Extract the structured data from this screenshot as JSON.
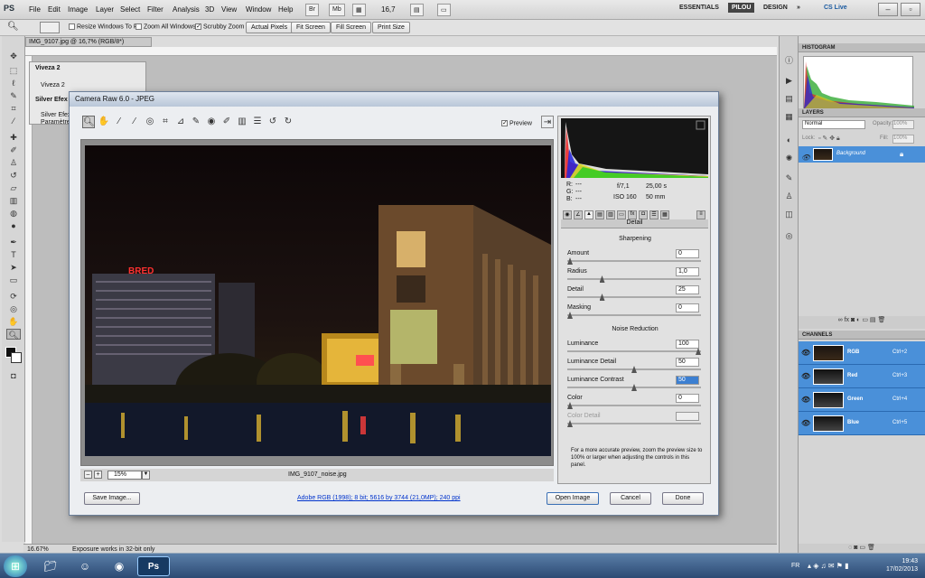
{
  "app": {
    "logo": "PS",
    "menu": [
      "File",
      "Edit",
      "Image",
      "Layer",
      "Select",
      "Filter",
      "Analysis",
      "3D",
      "View",
      "Window",
      "Help"
    ],
    "zoom_value": "16,7",
    "workspaces": [
      "ESSENTIALS",
      "PILOU",
      "DESIGN"
    ],
    "more": "»",
    "cslive": "CS Live"
  },
  "options": {
    "resize_windows": "Resize Windows To Fit",
    "zoom_all": "Zoom All Windows",
    "scrubby": "Scrubby Zoom",
    "actual_pixels": "Actual Pixels",
    "fit_screen": "Fit Screen",
    "fill_screen": "Fill Screen",
    "print_size": "Print Size"
  },
  "document": {
    "tab": "IMG_9107.jpg @ 16,7% (RGB/8*)",
    "zoom_status": "16.67%",
    "status_msg": "Exposure works in 32-bit only"
  },
  "viveza": {
    "header": "Viveza 2",
    "item": "Viveza 2",
    "silver_header": "Silver Efex",
    "silver_item": "Silver Efex",
    "params": "Paramètre"
  },
  "camera_raw": {
    "title": "Camera Raw 6.0  -  JPEG",
    "preview_label": "Preview",
    "info": {
      "r": "R:",
      "g": "G:",
      "b": "B:",
      "dash": "---",
      "aperture": "f/7,1",
      "shutter": "25,00 s",
      "iso": "ISO 160",
      "focal": "50 mm"
    },
    "panel_title": "Detail",
    "sharpening": "Sharpening",
    "noise": "Noise Reduction",
    "sliders": [
      {
        "label": "Amount",
        "value": "0",
        "pos": 0.0
      },
      {
        "label": "Radius",
        "value": "1,0",
        "pos": 0.25
      },
      {
        "label": "Detail",
        "value": "25",
        "pos": 0.25
      },
      {
        "label": "Masking",
        "value": "0",
        "pos": 0.0
      },
      {
        "label": "Luminance",
        "value": "100",
        "pos": 1.0
      },
      {
        "label": "Luminance Detail",
        "value": "50",
        "pos": 0.5
      },
      {
        "label": "Luminance Contrast",
        "value": "50",
        "pos": 0.5
      },
      {
        "label": "Color",
        "value": "0",
        "pos": 0.0
      },
      {
        "label": "Color Detail",
        "value": "",
        "pos": 0.0
      }
    ],
    "note": "For a more accurate preview, zoom the preview size to 100% or larger when adjusting the controls in this panel.",
    "zoom": "15%",
    "filename": "IMG_9107_noise.jpg",
    "workflow_link": "Adobe RGB (1998); 8 bit; 5616 by 3744 (21,0MP); 240 ppi",
    "save_btn": "Save Image...",
    "open_btn": "Open Image",
    "cancel_btn": "Cancel",
    "done_btn": "Done",
    "image_signs": {
      "bred": "BRED"
    }
  },
  "panels": {
    "histogram": "HISTOGRAM",
    "layers": "LAYERS",
    "blend": "Normal",
    "opacity_label": "Opacity:",
    "opacity": "100%",
    "lock_label": "Lock:",
    "fill_label": "Fill:",
    "fill": "100%",
    "layer_name": "Background",
    "channels": "CHANNELS",
    "channel_rows": [
      {
        "name": "RGB",
        "key": "Ctrl+2"
      },
      {
        "name": "Red",
        "key": "Ctrl+3"
      },
      {
        "name": "Green",
        "key": "Ctrl+4"
      },
      {
        "name": "Blue",
        "key": "Ctrl+5"
      }
    ]
  },
  "taskbar": {
    "lang": "FR",
    "time": "19:43",
    "date": "17/02/2013"
  }
}
